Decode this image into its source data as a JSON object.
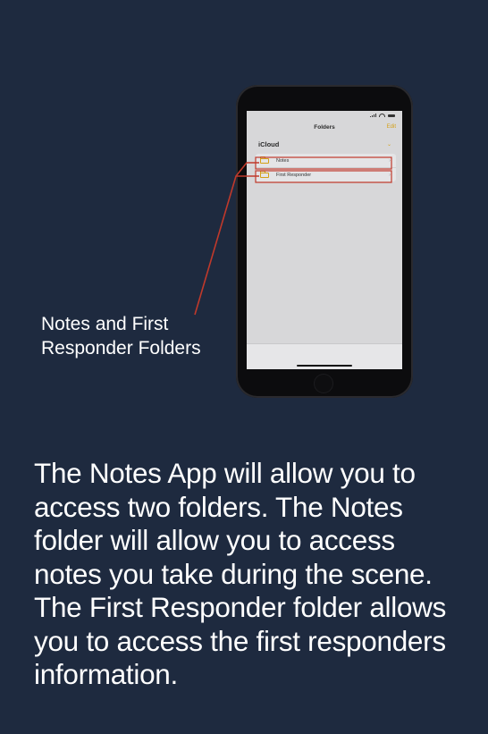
{
  "phone_screen": {
    "nav_title": "Folders",
    "edit_label": "Edit",
    "section": {
      "title": "iCloud",
      "chevron_icon": "chevron-down-icon"
    },
    "folders": [
      {
        "label": "Notes",
        "icon": "folder-icon"
      },
      {
        "label": "First Responder",
        "icon": "folder-icon"
      }
    ]
  },
  "callout": {
    "text": "Notes and First Responder Folders",
    "line_color": "#c0392b"
  },
  "description": "The Notes App will allow you to access two folders. The Notes folder will allow you to access notes you take during the scene. The First Responder folder allows you to access the first responders information.",
  "colors": {
    "background": "#1e2a3f",
    "accent": "#d4a017"
  }
}
